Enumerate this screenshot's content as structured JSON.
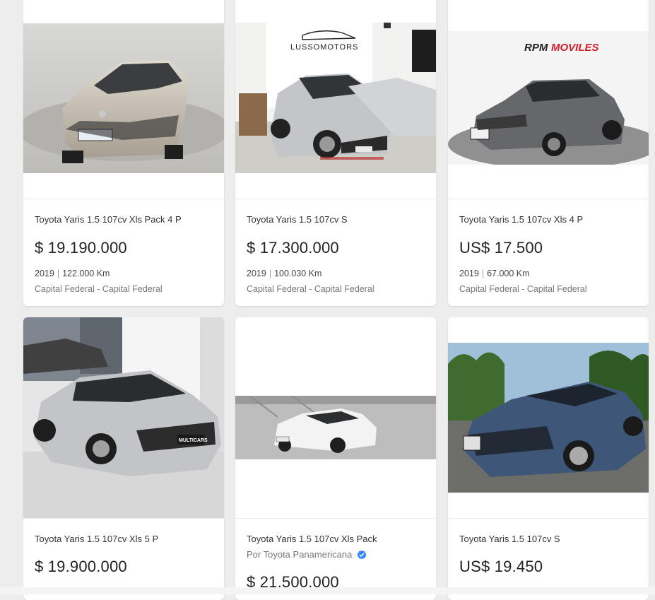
{
  "listings": [
    {
      "title": "Toyota Yaris 1.5 107cv Xls Pack 4 P",
      "price": "$ 19.190.000",
      "year": "2019",
      "km": "122.000 Km",
      "location": "Capital Federal - Capital Federal",
      "image_desc": "silver-sedan-front-studio"
    },
    {
      "title": "Toyota Yaris 1.5 107cv S",
      "price": "$ 17.300.000",
      "year": "2019",
      "km": "100.030 Km",
      "location": "Capital Federal - Capital Federal",
      "image_text": "LUSSOMOTORS"
    },
    {
      "title": "Toyota Yaris 1.5 107cv Xls 4 P",
      "price": "US$ 17.500",
      "year": "2019",
      "km": "67.000 Km",
      "location": "Capital Federal - Capital Federal",
      "image_text": "RPMMOVILES",
      "image_text_a": "RPM",
      "image_text_b": "MOVILES"
    },
    {
      "title": "Toyota Yaris 1.5 107cv Xls 5 P",
      "price": "$ 19.900.000",
      "image_text": "MULTICARS"
    },
    {
      "title": "Toyota Yaris 1.5 107cv Xls Pack",
      "seller": "Por Toyota Panamericana",
      "price": "$ 21.500.000"
    },
    {
      "title": "Toyota Yaris 1.5 107cv S",
      "price": "US$ 19.450"
    }
  ],
  "colors": {
    "background": "#ededed",
    "card": "#ffffff",
    "verified_badge": "#3483fa"
  },
  "icons": {
    "verified": "verified-badge-icon"
  }
}
